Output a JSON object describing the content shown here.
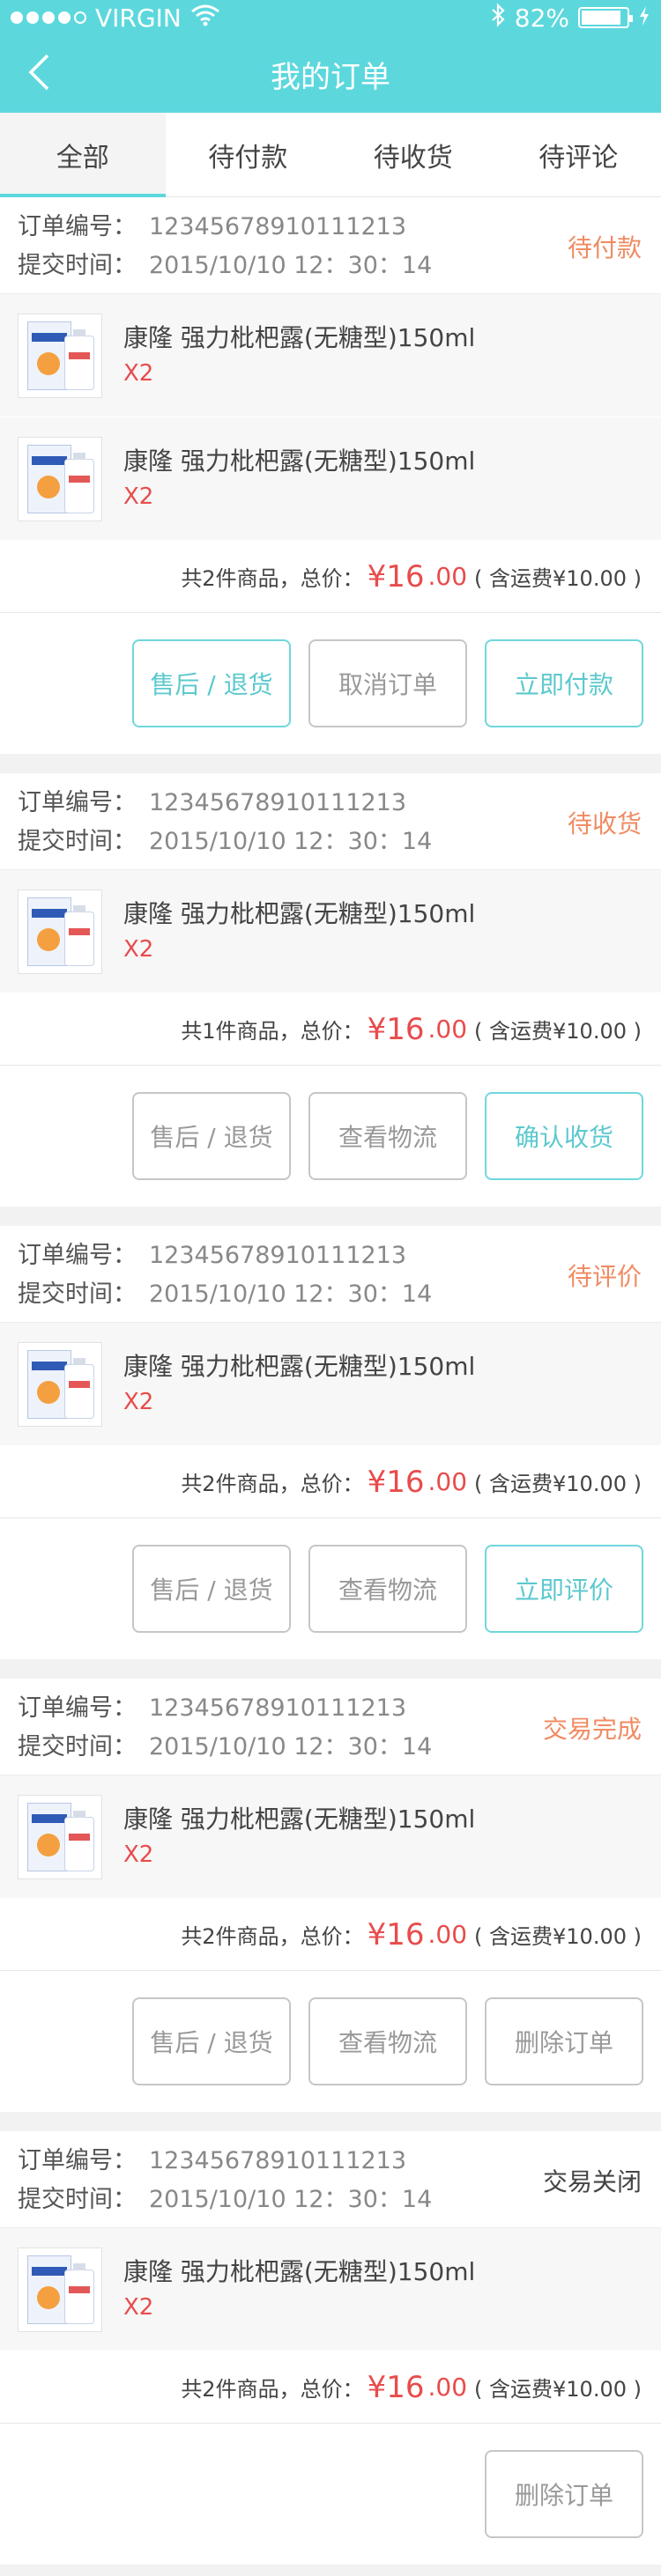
{
  "statusbar": {
    "carrier": "VIRGIN",
    "battery_percent": "82%",
    "battery_level": 0.82
  },
  "header": {
    "title": "我的订单"
  },
  "tabs": [
    {
      "label": "全部",
      "active": true
    },
    {
      "label": "待付款",
      "active": false
    },
    {
      "label": "待收货",
      "active": false
    },
    {
      "label": "待评论",
      "active": false
    }
  ],
  "labels": {
    "order_no": "订单编号：",
    "submit_time": "提交时间："
  },
  "orders": [
    {
      "order_no": "12345678910111213",
      "submit_time": "2015/10/10  12：30：14",
      "status": "待付款",
      "status_color": "#f08b62",
      "items": [
        {
          "name": "康隆 强力枇杷露(无糖型)150ml",
          "qty": "X2"
        },
        {
          "name": "康隆 强力枇杷露(无糖型)150ml",
          "qty": "X2"
        }
      ],
      "summary_prefix": "共2件商品，总价：",
      "price_int": "¥16",
      "price_dec": ".00",
      "shipping": "( 含运费¥10.00 )",
      "actions": [
        {
          "label": "售后 / 退货",
          "style": "teal"
        },
        {
          "label": "取消订单",
          "style": "gray"
        },
        {
          "label": "立即付款",
          "style": "teal"
        }
      ]
    },
    {
      "order_no": "12345678910111213",
      "submit_time": "2015/10/10  12：30：14",
      "status": "待收货",
      "status_color": "#f08b62",
      "items": [
        {
          "name": "康隆 强力枇杷露(无糖型)150ml",
          "qty": "X2"
        }
      ],
      "summary_prefix": "共1件商品，总价：",
      "price_int": "¥16",
      "price_dec": ".00",
      "shipping": "( 含运费¥10.00 )",
      "actions": [
        {
          "label": "售后 / 退货",
          "style": "gray"
        },
        {
          "label": "查看物流",
          "style": "gray"
        },
        {
          "label": "确认收货",
          "style": "teal"
        }
      ]
    },
    {
      "order_no": "12345678910111213",
      "submit_time": "2015/10/10  12：30：14",
      "status": "待评价",
      "status_color": "#f08b62",
      "items": [
        {
          "name": "康隆 强力枇杷露(无糖型)150ml",
          "qty": "X2"
        }
      ],
      "summary_prefix": "共2件商品，总价：",
      "price_int": "¥16",
      "price_dec": ".00",
      "shipping": "( 含运费¥10.00 )",
      "actions": [
        {
          "label": "售后 / 退货",
          "style": "gray"
        },
        {
          "label": "查看物流",
          "style": "gray"
        },
        {
          "label": "立即评价",
          "style": "teal"
        }
      ]
    },
    {
      "order_no": "12345678910111213",
      "submit_time": "2015/10/10  12：30：14",
      "status": "交易完成",
      "status_color": "#f08b62",
      "items": [
        {
          "name": "康隆 强力枇杷露(无糖型)150ml",
          "qty": "X2"
        }
      ],
      "summary_prefix": "共2件商品，总价：",
      "price_int": "¥16",
      "price_dec": ".00",
      "shipping": "( 含运费¥10.00 )",
      "actions": [
        {
          "label": "售后 / 退货",
          "style": "gray"
        },
        {
          "label": "查看物流",
          "style": "gray"
        },
        {
          "label": "删除订单",
          "style": "gray"
        }
      ]
    },
    {
      "order_no": "12345678910111213",
      "submit_time": "2015/10/10  12：30：14",
      "status": "交易关闭",
      "status_color": "#444444",
      "items": [
        {
          "name": "康隆 强力枇杷露(无糖型)150ml",
          "qty": "X2"
        }
      ],
      "summary_prefix": "共2件商品，总价：",
      "price_int": "¥16",
      "price_dec": ".00",
      "shipping": "( 含运费¥10.00 )",
      "actions": [
        {
          "label": "删除订单",
          "style": "gray"
        }
      ]
    }
  ],
  "icons": {
    "back": "chevron-left-icon",
    "wifi": "wifi-icon",
    "bluetooth": "bluetooth-icon",
    "battery": "battery-icon",
    "charging": "charging-bolt-icon"
  },
  "colors": {
    "header_bg": "#5cd8dd",
    "accent_teal": "#5cc9ce",
    "price_red": "#e84c4c",
    "status_orange": "#f08b62"
  }
}
